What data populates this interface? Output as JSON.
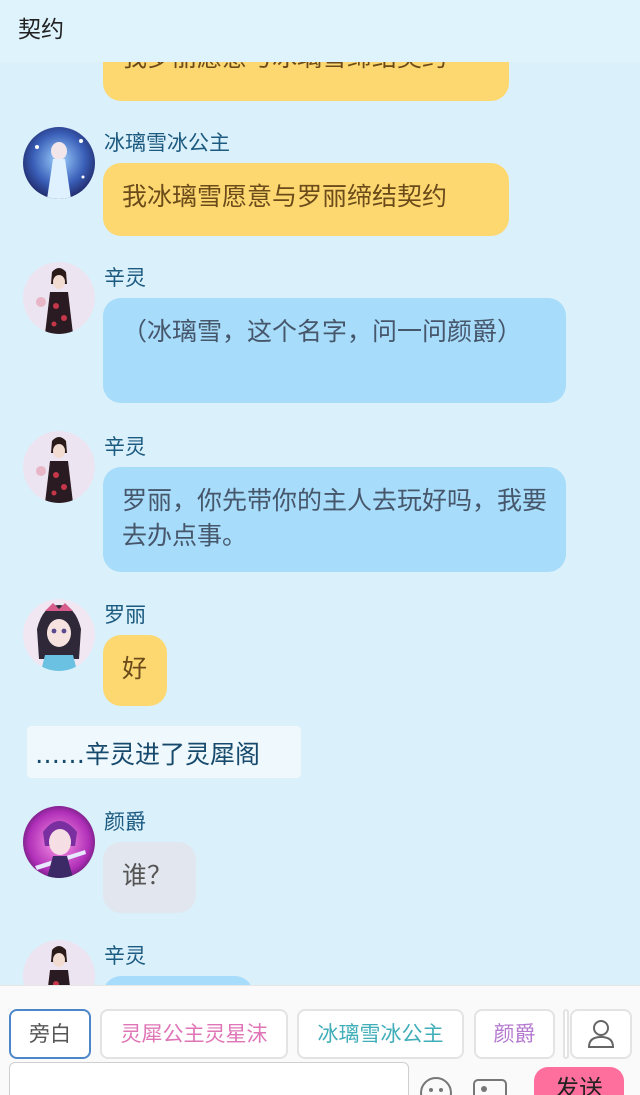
{
  "header": {
    "title": "契约"
  },
  "messages": [
    {
      "text": "我罗丽愿意与冰璃雪缔结契约"
    },
    {
      "name": "冰璃雪冰公主",
      "text": "我冰璃雪愿意与罗丽缔结契约"
    },
    {
      "name": "辛灵",
      "text": "（冰璃雪，这个名字，问一问颜爵）"
    },
    {
      "name": "辛灵",
      "text": "罗丽，你先带你的主人去玩好吗，我要去办点事。"
    },
    {
      "name": "罗丽",
      "text": "好"
    },
    {
      "name": "颜爵",
      "text": "谁？"
    },
    {
      "name": "辛灵",
      "text": ""
    }
  ],
  "narration": "……辛灵进了灵犀阁",
  "toolbar": {
    "roles": [
      "旁白",
      "灵犀公主灵星沫",
      "冰璃雪冰公主",
      "颜爵"
    ],
    "send_label": "发送"
  },
  "colors": {
    "background": "#daf0fb",
    "yellow_bubble": "#fdd871",
    "blue_bubble": "#a7dcfa",
    "gray_bubble": "#e2e6ee",
    "send_button": "#ff6f9e"
  }
}
